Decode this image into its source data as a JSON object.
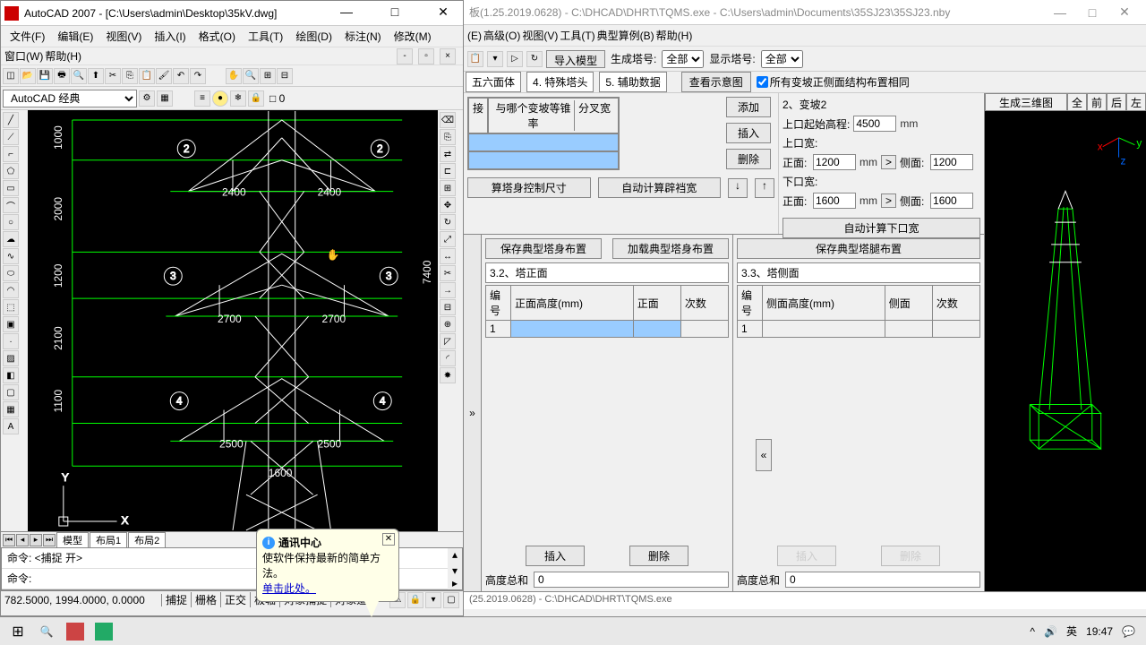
{
  "autocad": {
    "title": "AutoCAD 2007 - [C:\\Users\\admin\\Desktop\\35kV.dwg]",
    "menus": [
      "文件(F)",
      "编辑(E)",
      "视图(V)",
      "插入(I)",
      "格式(O)",
      "工具(T)",
      "绘图(D)",
      "标注(N)",
      "修改(M)"
    ],
    "menus2": [
      "窗口(W)",
      "帮助(H)"
    ],
    "workspace": "AutoCAD 经典",
    "layer_value": "□ 0",
    "tabs": [
      "模型",
      "布局1",
      "布局2"
    ],
    "cmd1": "命令:  <捕捉 开>",
    "cmd2": "命令:",
    "coords": "782.5000, 1994.0000, 0.0000",
    "status_btns": [
      "捕捉",
      "栅格",
      "正交",
      "极轴",
      "对象捕捉",
      "对象追"
    ],
    "dims": {
      "w1": "2400",
      "w2": "2400",
      "w3": "2700",
      "w4": "2700",
      "w5": "2500",
      "w6": "2500",
      "w7": "1600",
      "h1": "1000",
      "h2": "2000",
      "h3": "1200",
      "h4": "2100",
      "h5": "1100",
      "y_total": "7400"
    },
    "nodes": {
      "n2": "2",
      "n3": "3",
      "n4": "4"
    }
  },
  "balloon": {
    "title": "通讯中心",
    "body": "使软件保持最新的简单方法。",
    "link": "单击此处。"
  },
  "right": {
    "title": "板(1.25.2019.0628) - C:\\DHCAD\\DHRT\\TQMS.exe - C:\\Users\\admin\\Documents\\35SJ23\\35SJ23.nby",
    "menus": [
      "(E)",
      "高级(O)",
      "视图(V)",
      "工具(T)",
      "典型算例(B)",
      "帮助(H)"
    ],
    "import_btn": "导入模型",
    "gen_label": "生成塔号:",
    "gen_all": "全部",
    "show_label": "显示塔号:",
    "show_all": "全部",
    "tabs": [
      "五六面体",
      "4. 特殊塔头",
      "5. 辅助数据"
    ],
    "view_diagram": "查看示意图",
    "checkbox": "所有变坡正侧面结构布置相同",
    "grid_hdr1": "接",
    "grid_hdr2": "与哪个变坡等锥率",
    "grid_hdr3": "分叉宽",
    "btn_add": "添加",
    "btn_insert": "插入",
    "btn_delete": "删除",
    "calc_size": "算塔身控制尺寸",
    "calc_width": "自动计算辟裆宽",
    "section2_title": "2、变坡2",
    "top_elev_label": "上口起始高程:",
    "top_elev": "4500",
    "top_width_label": "上口宽:",
    "front_label": "正面:",
    "front1": "1200",
    "side_label": "侧面:",
    "side1": "1200",
    "bot_width_label": "下口宽:",
    "front2": "1600",
    "side2": "1600",
    "calc_bottom": "自动计算下口宽",
    "unit_mm": "mm",
    "save_body": "保存典型塔身布置",
    "load_body": "加载典型塔身布置",
    "save_leg": "保存典型塔腿布置",
    "sec32": "3.2、塔正面",
    "sec33": "3.3、塔侧面",
    "col_id": "编号",
    "col_h_front": "正面高度(mm)",
    "col_front": "正面",
    "col_times": "次数",
    "col_h_side": "侧面高度(mm)",
    "col_side": "侧面",
    "row1": "1",
    "btn_insert2": "插入",
    "btn_delete2": "删除",
    "total_h": "高度总和",
    "total_val": "0",
    "gen3d": "生成三维图",
    "view_all": "全",
    "view_front": "前",
    "view_back": "后",
    "view_left": "左",
    "status": "(25.2019.0628) - C:\\DHCAD\\DHRT\\TQMS.exe"
  },
  "taskbar": {
    "ime": "英",
    "time": "19:47"
  }
}
